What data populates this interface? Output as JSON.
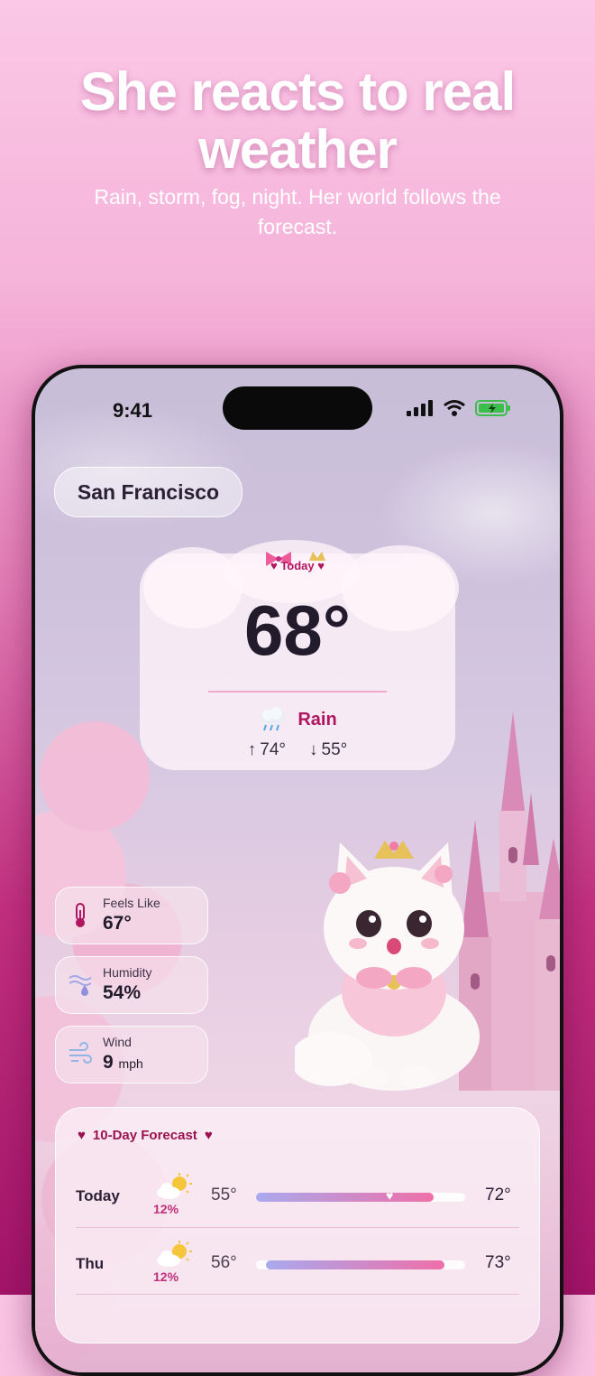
{
  "headline": "She reacts to real weather",
  "subhead": "Rain, storm, fog, night. Her world follows the forecast.",
  "status": {
    "time": "9:41"
  },
  "location": "San Francisco",
  "today": {
    "tag": "Today",
    "temp": "68°",
    "condition": "Rain",
    "high": "74°",
    "low": "55°"
  },
  "stats": [
    {
      "label": "Feels Like",
      "value": "67°",
      "unit": "",
      "icon": "thermometer-icon"
    },
    {
      "label": "Humidity",
      "value": "54%",
      "unit": "",
      "icon": "humidity-icon"
    },
    {
      "label": "Wind",
      "value": "9",
      "unit": "mph",
      "icon": "wind-icon"
    }
  ],
  "forecast": {
    "title": "10-Day Forecast",
    "rows": [
      {
        "day": "Today",
        "precip": "12%",
        "low": "55°",
        "high": "72°",
        "icon": "partly-sunny-icon"
      },
      {
        "day": "Thu",
        "precip": "12%",
        "low": "56°",
        "high": "73°",
        "icon": "partly-sunny-icon"
      }
    ]
  },
  "colors": {
    "accent": "#b0155f",
    "text": "#221b2c",
    "bar_start": "#a9a9ee",
    "bar_end": "#ee6fa8"
  }
}
